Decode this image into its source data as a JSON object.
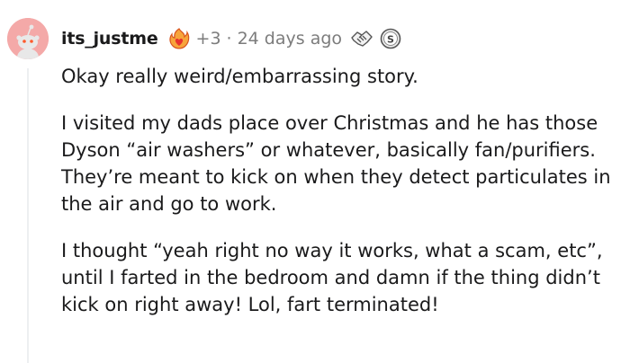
{
  "comment": {
    "author": "its_justme",
    "award_extra": "+3",
    "separator": "·",
    "time_ago": "24 days ago",
    "paragraphs": [
      "Okay really weird/embarrassing story.",
      "I visited my dads place over Christmas and he has those Dyson “air washers” or whatever, basically fan/purifiers. They’re meant to kick on when they detect particulates in the air and go to work.",
      "I thought “yeah right no way it works, what a scam, etc”, until I farted in the bedroom and damn if the thing didn’t kick on right away! Lol, fart terminated!"
    ]
  },
  "colors": {
    "avatar_bg": "#f4a9a8",
    "meta_gray": "#7c7c7c",
    "thread_line": "#edeff1"
  },
  "icons": {
    "avatar": "reddit-snoo-avatar-icon",
    "award_1": "fire-heart-award-icon",
    "award_2": "handshake-award-icon",
    "award_3": "silver-coin-award-icon"
  }
}
